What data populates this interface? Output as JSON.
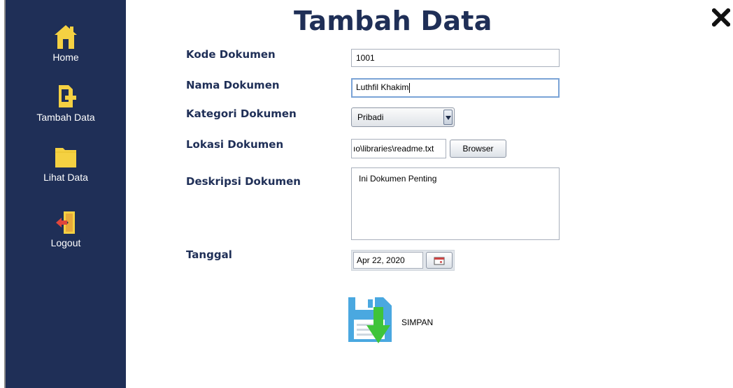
{
  "sidebar": {
    "items": [
      {
        "label": "Home",
        "icon": "home-icon"
      },
      {
        "label": "Tambah Data",
        "icon": "add-file-icon"
      },
      {
        "label": "Lihat Data",
        "icon": "folder-icon"
      },
      {
        "label": "Logout",
        "icon": "logout-icon"
      }
    ]
  },
  "page": {
    "title": "Tambah Data"
  },
  "form": {
    "kode": {
      "label": "Kode Dokumen",
      "value": "1001"
    },
    "nama": {
      "label": "Nama Dokumen",
      "value": "Luthfil Khakim"
    },
    "kategori": {
      "label": "Kategori Dokumen",
      "value": "Pribadi"
    },
    "lokasi": {
      "label": "Lokasi Dokumen",
      "value": "ıo\\libraries\\readme.txt",
      "browse_label": "Browser"
    },
    "deskripsi": {
      "label": "Deskripsi Dokumen",
      "value": "Ini Dokumen Penting"
    },
    "tanggal": {
      "label": "Tanggal",
      "value": "Apr 22, 2020"
    }
  },
  "save": {
    "label": "SIMPAN",
    "icon": "floppy-save-icon"
  },
  "colors": {
    "sidebar_bg": "#1f2f57",
    "title": "#1f2f57",
    "icon_yellow": "#f5d142",
    "save_blue": "#4aa8e0",
    "save_green": "#3fc43a"
  }
}
